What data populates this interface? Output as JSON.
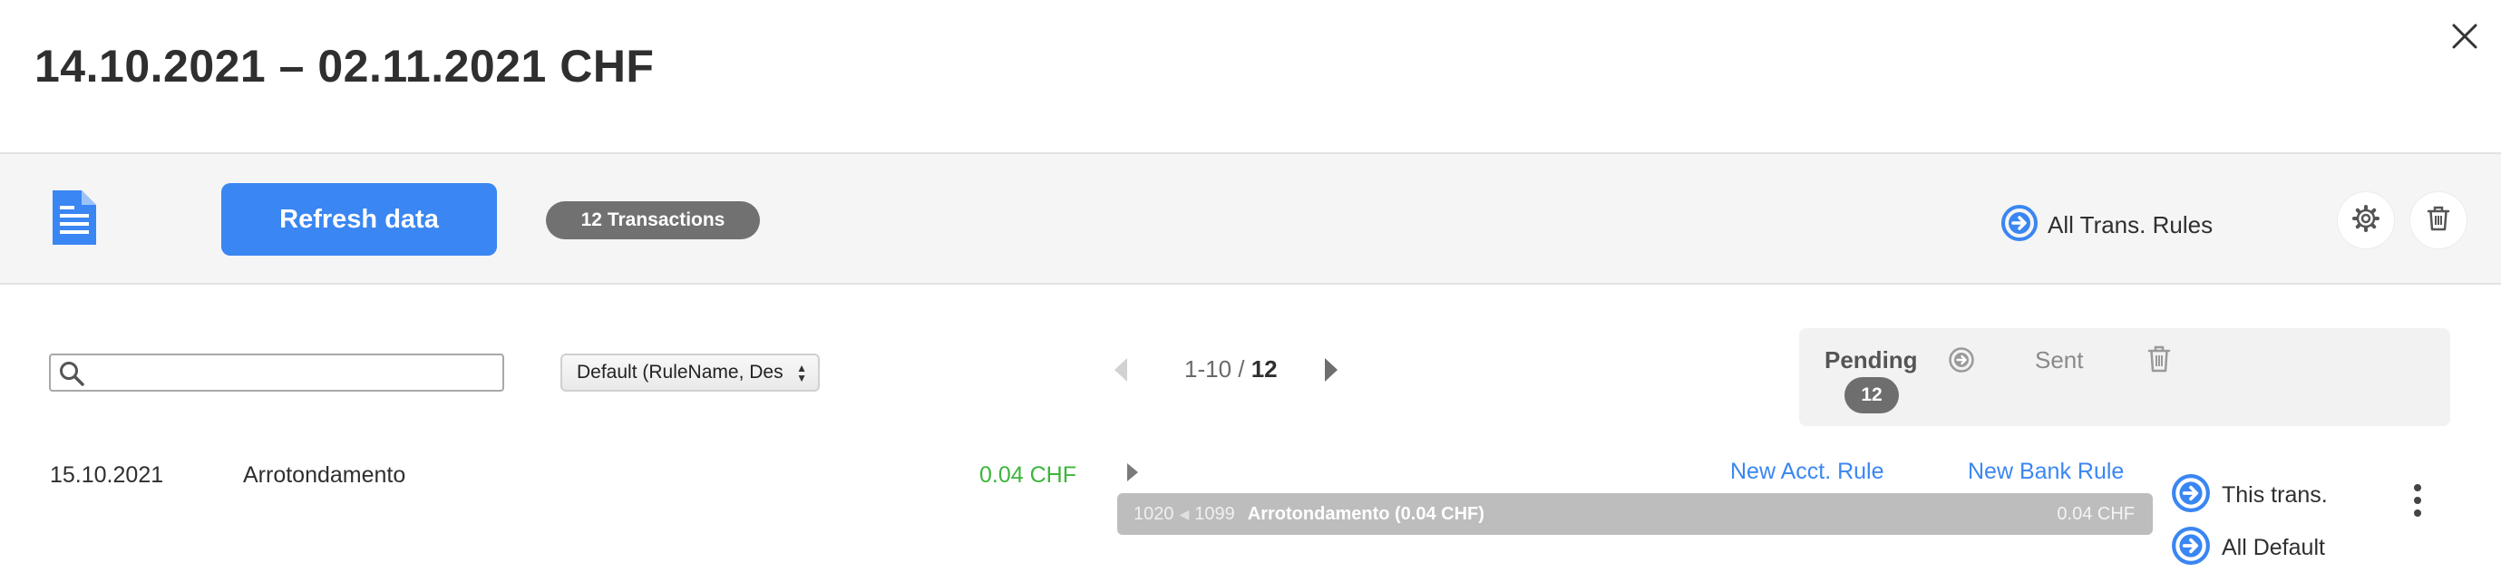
{
  "header": {
    "title": "14.10.2021 – 02.11.2021 CHF"
  },
  "toolbar": {
    "refresh_label": "Refresh data",
    "transactions_badge": "12 Transactions",
    "all_rules_label": "All Trans. Rules"
  },
  "filters": {
    "search_value": "",
    "sort_selected": "Default (RuleName, Des"
  },
  "pager": {
    "range": "1-10 / ",
    "total": "12"
  },
  "status": {
    "pending_label": "Pending",
    "pending_count": "12",
    "sent_label": "Sent"
  },
  "transactions": [
    {
      "date": "15.10.2021",
      "description": "Arrotondamento",
      "amount": "0.04 CHF",
      "new_acct_rule": "New Acct. Rule",
      "new_bank_rule": "New Bank Rule",
      "rule": {
        "debit_account": "1020",
        "credit_account": "1099",
        "name": "Arrotondamento (0.04 CHF)",
        "amount": "0.04 CHF"
      },
      "option_this": "This trans.",
      "option_default": "All Default"
    }
  ],
  "colors": {
    "accent": "#3a86f2",
    "amount_positive": "#3cb53c",
    "pill": "#717171",
    "rule_bar": "#bdbdbd"
  },
  "icons": {
    "close": "close-icon",
    "document": "document-icon",
    "arrow_circle": "arrow-circle-icon",
    "gear": "gear-icon",
    "trash": "trash-icon",
    "search": "search-icon",
    "kebab": "kebab-menu-icon"
  }
}
